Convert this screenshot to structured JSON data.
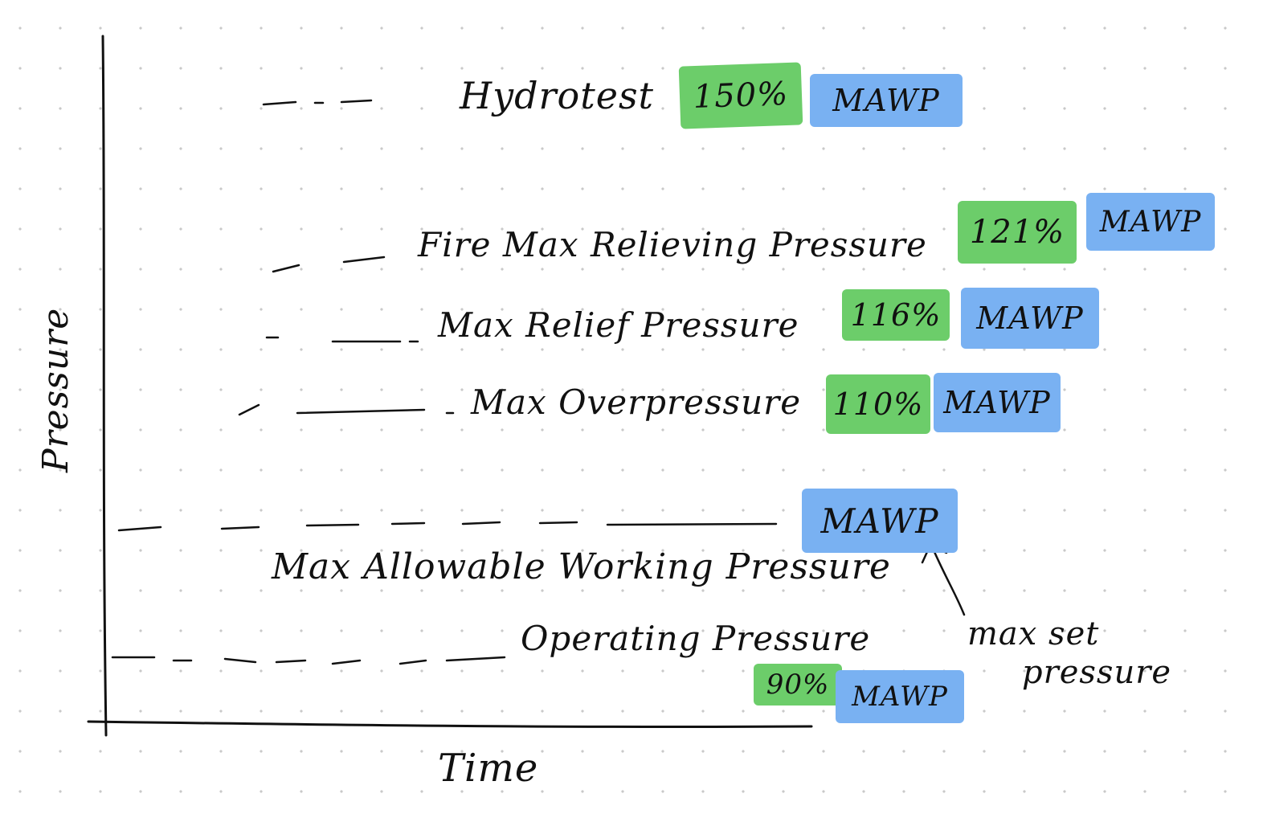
{
  "axes": {
    "y_label": "Pressure",
    "x_label": "Time"
  },
  "levels": [
    {
      "id": "hydrotest",
      "label": "Hydrotest",
      "percent": "150%",
      "unit": "MAWP",
      "percent_value": 150
    },
    {
      "id": "fire-max-relieving",
      "label": "Fire Max Relieving Pressure",
      "percent": "121%",
      "unit": "MAWP",
      "percent_value": 121
    },
    {
      "id": "max-relief",
      "label": "Max Relief Pressure",
      "percent": "116%",
      "unit": "MAWP",
      "percent_value": 116
    },
    {
      "id": "max-overpressure",
      "label": "Max Overpressure",
      "percent": "110%",
      "unit": "MAWP",
      "percent_value": 110
    },
    {
      "id": "mawp",
      "label": "Max Allowable Working Pressure",
      "unit": "MAWP",
      "percent_value": 100
    },
    {
      "id": "operating",
      "label": "Operating Pressure",
      "percent": "90%",
      "unit": "MAWP",
      "percent_value": 90
    }
  ],
  "annotation": {
    "line1": "max set",
    "line2": "pressure"
  },
  "colors": {
    "percent_highlight": "#6ccd6a",
    "unit_highlight": "#79b1f2",
    "ink": "#111111",
    "dot_grid": "#c9c9c9"
  }
}
